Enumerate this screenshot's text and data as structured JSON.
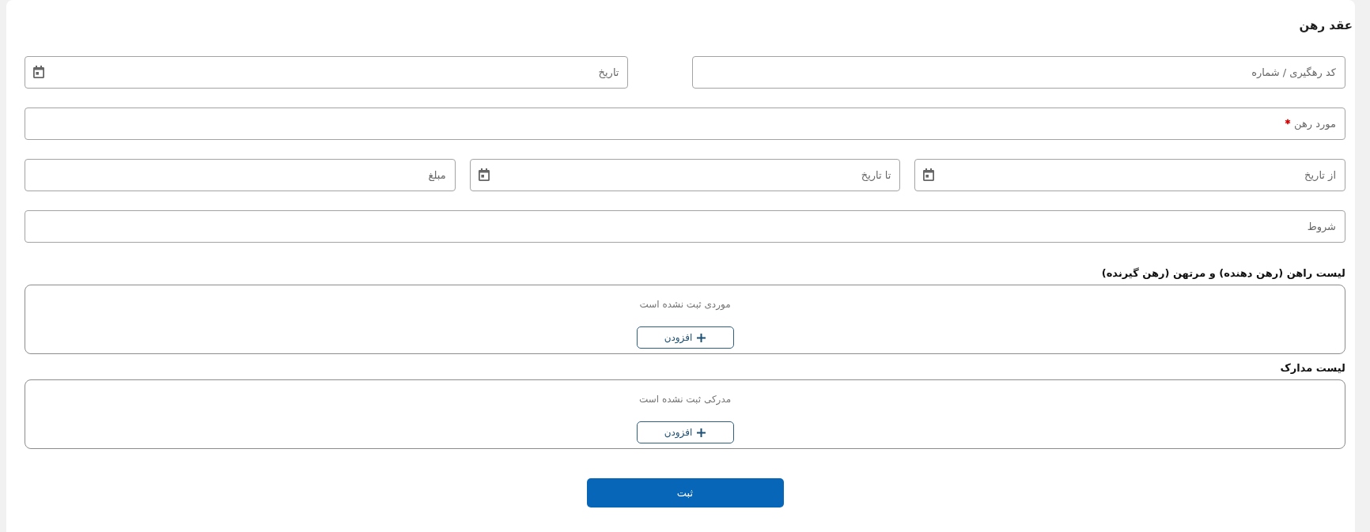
{
  "form": {
    "title": "عقد رهن",
    "rows": [
      {
        "fields": [
          {
            "kind": "text",
            "placeholder": "کد رهگیری / شماره",
            "required": false
          },
          {
            "kind": "date",
            "placeholder": "تاریخ",
            "required": false
          }
        ]
      },
      {
        "fields": [
          {
            "kind": "text",
            "placeholder": "مورد رهن",
            "required": true
          }
        ]
      },
      {
        "fields": [
          {
            "kind": "date",
            "placeholder": "از تاریخ",
            "required": false
          },
          {
            "kind": "date",
            "placeholder": "تا تاریخ",
            "required": false
          },
          {
            "kind": "text",
            "placeholder": "مبلغ",
            "required": false
          }
        ]
      },
      {
        "fields": [
          {
            "kind": "text",
            "placeholder": "شروط",
            "required": false
          }
        ]
      }
    ]
  },
  "lists": [
    {
      "title": "لیست راهن (رهن دهنده) و مرتهن (رهن گیرنده)",
      "empty_text": "موردی ثبت نشده است",
      "add_button": "افزودن"
    },
    {
      "title": "لیست مدارک",
      "empty_text": "مدرکی ثبت نشده است",
      "add_button": "افزودن"
    }
  ],
  "submit_button": "ثبت"
}
